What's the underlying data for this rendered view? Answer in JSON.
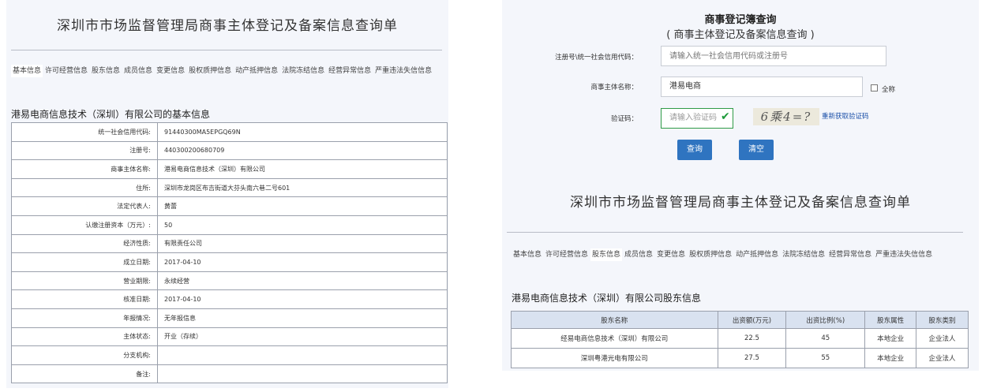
{
  "left": {
    "title": "深圳市市场监督管理局商事主体登记及备案信息查询单",
    "tabs": [
      "基本信息",
      "许可经营信息",
      "股东信息",
      "成员信息",
      "变更信息",
      "股权质押信息",
      "动产抵押信息",
      "法院冻结信息",
      "经营异常信息",
      "严重违法失信信息"
    ],
    "active_tab": 0,
    "section_title": "港易电商信息技术（深圳）有限公司的基本信息",
    "rows": [
      {
        "label": "统一社会信用代码:",
        "value": "91440300MA5EPGQ69N"
      },
      {
        "label": "注册号:",
        "value": "440300200680709"
      },
      {
        "label": "商事主体名称:",
        "value": "港易电商信息技术（深圳）有限公司"
      },
      {
        "label": "住所:",
        "value": "深圳市龙岗区布吉街道大芬头南六巷二号601"
      },
      {
        "label": "法定代表人:",
        "value": "黄蕾"
      },
      {
        "label": "认缴注册资本（万元）:",
        "value": "50"
      },
      {
        "label": "经济性质:",
        "value": "有限责任公司"
      },
      {
        "label": "成立日期:",
        "value": "2017-04-10"
      },
      {
        "label": "营业期限:",
        "value": "永续经营"
      },
      {
        "label": "核准日期:",
        "value": "2017-04-10"
      },
      {
        "label": "年报情况:",
        "value": "无年报信息"
      },
      {
        "label": "主体状态:",
        "value": "开业（存续）"
      },
      {
        "label": "分支机构:",
        "value": ""
      },
      {
        "label": "备注:",
        "value": ""
      }
    ]
  },
  "right": {
    "query_title": "商事登记簿查询",
    "query_subtitle": "( 商事主体登记及备案信息查询 )",
    "form": {
      "reg_label": "注册号\\统一社会信用代码：",
      "reg_placeholder": "请输入统一社会信用代码或注册号",
      "name_label": "商事主体名称：",
      "name_value": "港易电商",
      "fullname_label": "全称",
      "captcha_label": "验证码：",
      "captcha_placeholder": "请输入验证码",
      "captcha_text": "6乘4=?",
      "refresh_captcha": "重新获取验证码",
      "query_button": "查询",
      "clear_button": "清空"
    },
    "title": "深圳市市场监督管理局商事主体登记及备案信息查询单",
    "tabs": [
      "基本信息",
      "许可经营信息",
      "股东信息",
      "成员信息",
      "变更信息",
      "股权质押信息",
      "动产抵押信息",
      "法院冻结信息",
      "经营异常信息",
      "严重违法失信信息"
    ],
    "active_tab": 2,
    "section_title": "港易电商信息技术（深圳）有限公司股东信息",
    "table_headers": [
      "股东名称",
      "出资额(万元)",
      "出资比例(%)",
      "股东属性",
      "股东类别"
    ],
    "table_rows": [
      [
        "经易电商信息技术（深圳）有限公司",
        "22.5",
        "45",
        "本地企业",
        "企业法人"
      ],
      [
        "深圳粤港光电有限公司",
        "27.5",
        "55",
        "本地企业",
        "企业法人"
      ]
    ]
  }
}
